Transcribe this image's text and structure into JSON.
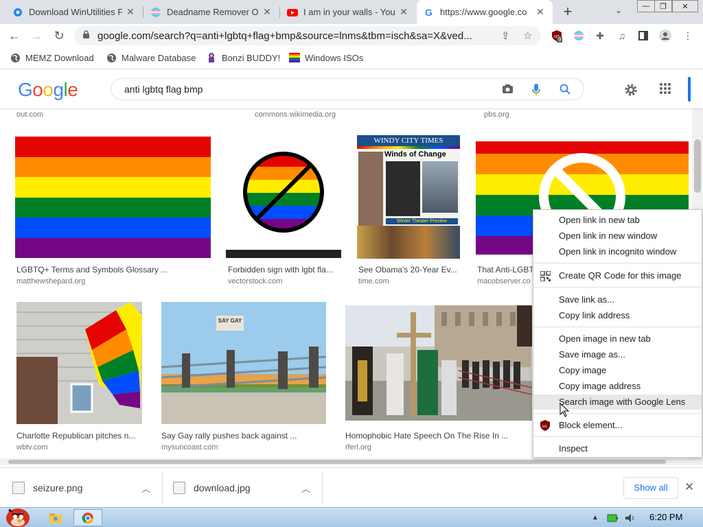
{
  "tabs": [
    {
      "title": "Download WinUtilities F",
      "favicon": "gear-icon"
    },
    {
      "title": "Deadname Remover Op",
      "favicon": "trans-flag-icon"
    },
    {
      "title": "I am in your walls - You",
      "favicon": "youtube-icon"
    },
    {
      "title": "https://www.google.co",
      "favicon": "google-icon",
      "active": true
    }
  ],
  "toolbar": {
    "url": "google.com/search?q=anti+lgbtq+flag+bmp&source=lnms&tbm=isch&sa=X&ved...",
    "ublock_badge": "9"
  },
  "bookmarks": [
    {
      "label": "MEMZ Download",
      "icon": "globe-icon"
    },
    {
      "label": "Malware Database",
      "icon": "globe-icon"
    },
    {
      "label": "Bonzi BUDDY!",
      "icon": "bonzi-icon"
    },
    {
      "label": "Windows ISOs",
      "icon": "rainbow-flag-icon"
    }
  ],
  "google": {
    "logo": [
      "G",
      "o",
      "o",
      "g",
      "l",
      "e"
    ],
    "logo_colors": [
      "#4285f4",
      "#ea4335",
      "#fbbc05",
      "#4285f4",
      "#34a853",
      "#ea4335"
    ],
    "query": "anti lgbtq flag bmp"
  },
  "top_sources": [
    "out.com",
    "commons.wikimedia.org",
    "pbs.org"
  ],
  "results_row1": [
    {
      "caption": "LGBTQ+ Terms and Symbols Glossary ...",
      "source": "matthewshepard.org"
    },
    {
      "caption": "Forbidden sign with lgbt fla...",
      "source": "vectorstock.com"
    },
    {
      "caption": "See Obama's 20-Year Ev...",
      "source": "time.com"
    },
    {
      "caption": "That Anti-LGBT",
      "source": "macobserver.co"
    }
  ],
  "results_row2": [
    {
      "caption": "Charlotte Republican pitches n...",
      "source": "wbtv.com"
    },
    {
      "caption": "Say Gay rally pushes back against ...",
      "source": "mysuncoast.com"
    },
    {
      "caption": "Homophobic Hate Speech On The Rise In ...",
      "source": "rferl.org"
    }
  ],
  "image_text": {
    "windy_title": "WINDY CITY TIMES",
    "windy_headline": "Winds of Change",
    "windy_sub": "Winter Theater Preview",
    "sign_text": "SAY GAY"
  },
  "context_menu": {
    "group1": [
      "Open link in new tab",
      "Open link in new window",
      "Open link in incognito window"
    ],
    "qr": "Create QR Code for this image",
    "group2": [
      "Save link as...",
      "Copy link address"
    ],
    "group3": [
      "Open image in new tab",
      "Save image as...",
      "Copy image",
      "Copy image address",
      "Search image with Google Lens"
    ],
    "block": "Block element...",
    "inspect": "Inspect",
    "highlighted": "Search image with Google Lens"
  },
  "downloads": [
    {
      "file": "seizure.png"
    },
    {
      "file": "download.jpg"
    }
  ],
  "downloads_show_all": "Show all",
  "taskbar": {
    "clock": "6:20 PM"
  },
  "flag_colors": [
    "#e40303",
    "#ff8c00",
    "#ffed00",
    "#008026",
    "#004dff",
    "#750787"
  ]
}
